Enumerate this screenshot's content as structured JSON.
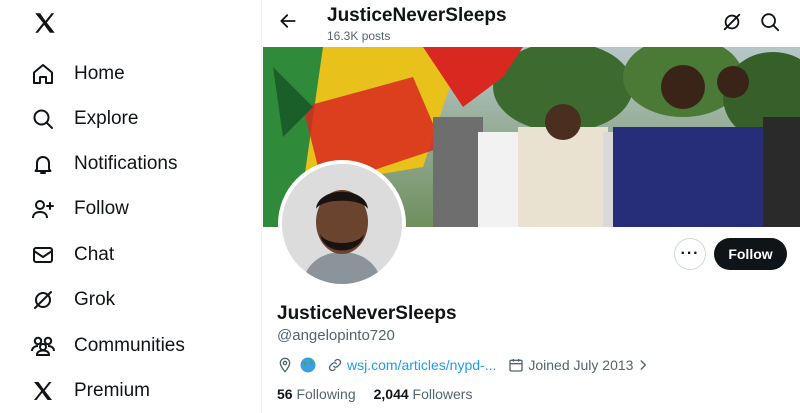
{
  "sidebar": {
    "logo_icon": "x-logo-icon",
    "items": [
      {
        "label": "Home",
        "icon": "home-icon"
      },
      {
        "label": "Explore",
        "icon": "search-icon"
      },
      {
        "label": "Notifications",
        "icon": "bell-icon"
      },
      {
        "label": "Follow",
        "icon": "person-add-icon"
      },
      {
        "label": "Chat",
        "icon": "envelope-icon"
      },
      {
        "label": "Grok",
        "icon": "grok-icon"
      },
      {
        "label": "Communities",
        "icon": "people-icon"
      },
      {
        "label": "Premium",
        "icon": "x-logo-icon"
      }
    ]
  },
  "header": {
    "title": "JusticeNeverSleeps",
    "subtitle": "16.3K posts"
  },
  "profile": {
    "display_name": "JusticeNeverSleeps",
    "handle": "@angelopinto720",
    "link": "wsj.com/articles/nypd-...",
    "joined": "Joined July 2013",
    "follow_label": "Follow",
    "more_label": "···",
    "following_count": "56",
    "following_label": "Following",
    "followers_count": "2,044",
    "followers_label": "Followers"
  },
  "colors": {
    "accent": "#1d9bf0",
    "text": "#0f1419",
    "muted": "#536471",
    "button_dark": "#0f1419"
  }
}
